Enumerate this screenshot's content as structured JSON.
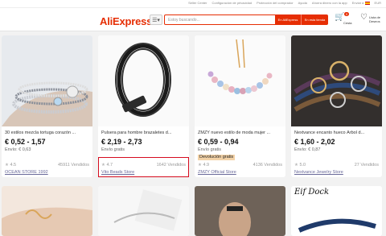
{
  "topbar": {
    "links": [
      "Seller Center",
      "Configuración de privacidad",
      "Protección del comprador",
      "Ayuda",
      "Ahorra dinero con la app",
      "Enviar a",
      "EUR"
    ]
  },
  "header": {
    "logo": "AliExpress",
    "category_icon": "menu-icon",
    "search_placeholder": "Estoy buscando...",
    "search_button": "En AliExpress",
    "search_store_button": "En esta tienda",
    "cart_count": "0",
    "cart_label": "Cesta",
    "wishlist_label": "Lista de Deseos"
  },
  "products": [
    {
      "title": "30 estilos mezcla tortuga corazón ...",
      "price": "€ 0,52 - 1,57",
      "shipping": "Envío: € 0,63",
      "badge": "",
      "rating": "4.5",
      "sold": "45911 Vendidos",
      "store": "OCEAN STORE 1992"
    },
    {
      "title": "Pulsera para hombre brazaletes d...",
      "price": "€ 2,19 - 2,73",
      "shipping": "Envío gratis",
      "badge": "",
      "rating": "4.7",
      "sold": "1642 Vendidos",
      "store": "Vito Beads Store"
    },
    {
      "title": "ZMZY nuevo estilo de moda mujer ...",
      "price": "€ 0,59 - 0,94",
      "shipping": "Envío gratis",
      "badge": "Devolución gratis",
      "rating": "4.9",
      "sold": "4136 Vendidos",
      "store": "ZMZY Official Store"
    },
    {
      "title": "Nextvance encanto hueco Árbol d...",
      "price": "€ 1,60 - 2,02",
      "shipping": "Envío: € 0,87",
      "badge": "",
      "rating": "5.0",
      "sold": "27 Vendidos",
      "store": "Nextvance Jewelry Store"
    }
  ],
  "row2": {
    "card4_text": "Eif Dock"
  },
  "colors": {
    "brand": "#e62e04",
    "highlight": "#d60c1f"
  }
}
